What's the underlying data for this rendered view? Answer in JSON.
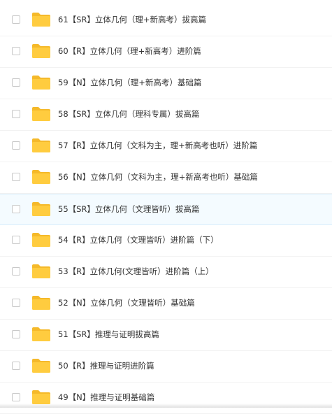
{
  "colors": {
    "folder_body": "#ffcc3f",
    "folder_tab": "#f5b92a",
    "hover_background": "#f4fbff",
    "text": "#333333"
  },
  "file_list": {
    "items": [
      {
        "name": "61【SR】立体几何（理+新高考）拔高篇",
        "icon": "folder-icon",
        "hovered": false
      },
      {
        "name": "60【R】立体几何（理+新高考）进阶篇",
        "icon": "folder-icon",
        "hovered": false
      },
      {
        "name": "59【N】立体几何（理+新高考）基础篇",
        "icon": "folder-icon",
        "hovered": false
      },
      {
        "name": "58【SR】立体几何（理科专属）拔高篇",
        "icon": "folder-icon",
        "hovered": false
      },
      {
        "name": "57【R】立体几何（文科为主，理+新高考也听）进阶篇",
        "icon": "folder-icon",
        "hovered": false
      },
      {
        "name": "56【N】立体几何（文科为主，理+新高考也听）基础篇",
        "icon": "folder-icon",
        "hovered": false
      },
      {
        "name": "55【SR】立体几何（文理皆听）拔高篇",
        "icon": "folder-icon",
        "hovered": true
      },
      {
        "name": "54【R】立体几何（文理皆听）进阶篇（下）",
        "icon": "folder-icon",
        "hovered": false
      },
      {
        "name": "53【R】立体几何(文理皆听）进阶篇（上）",
        "icon": "folder-icon",
        "hovered": false
      },
      {
        "name": "52【N】立体几何（文理皆听）基础篇",
        "icon": "folder-icon",
        "hovered": false
      },
      {
        "name": "51【SR】推理与证明拔高篇",
        "icon": "folder-icon",
        "hovered": false
      },
      {
        "name": "50【R】推理与证明进阶篇",
        "icon": "folder-icon",
        "hovered": false
      },
      {
        "name": "49【N】推理与证明基础篇",
        "icon": "folder-icon",
        "hovered": false
      }
    ]
  }
}
